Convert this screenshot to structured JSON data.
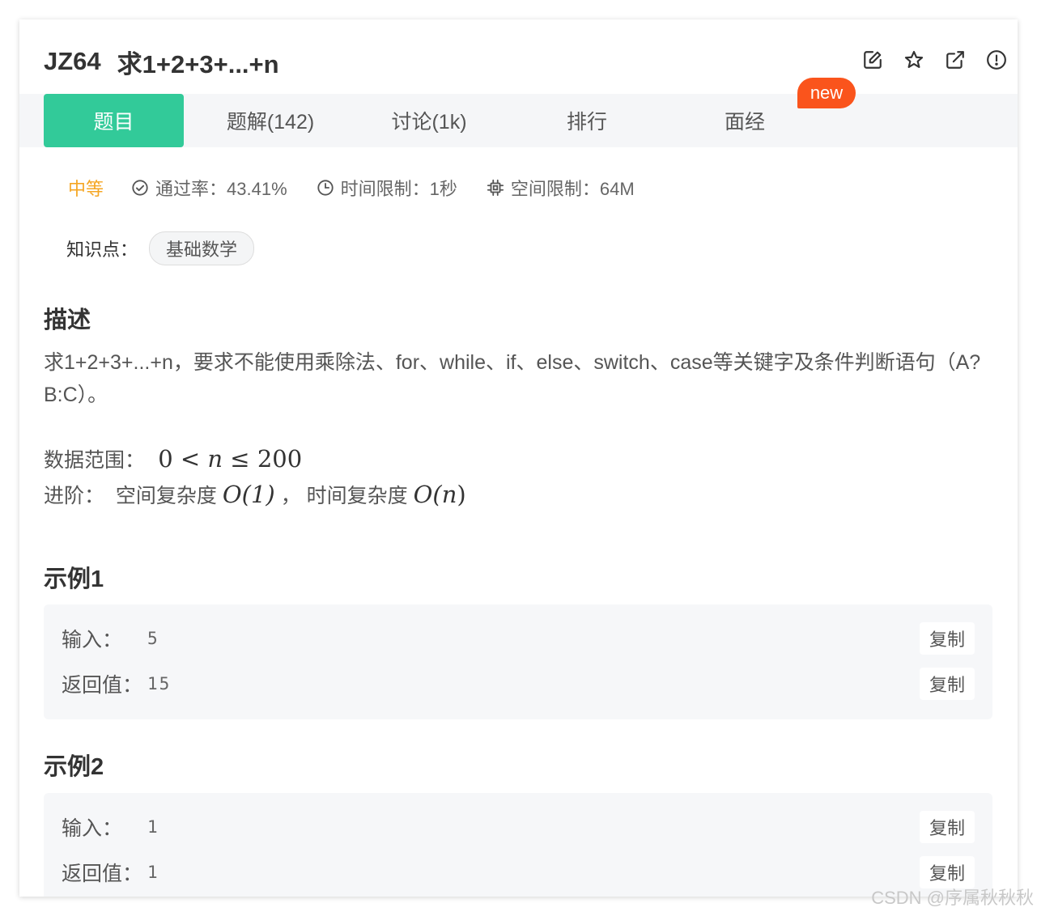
{
  "problem": {
    "id": "JZ64",
    "title": "求1+2+3+...+n"
  },
  "actions": [
    {
      "icon": "edit-icon"
    },
    {
      "icon": "star-icon"
    },
    {
      "icon": "share-icon"
    },
    {
      "icon": "report-icon"
    }
  ],
  "tabs": [
    {
      "label": "题目",
      "active": true
    },
    {
      "label": "题解(142)"
    },
    {
      "label": "讨论(1k)"
    },
    {
      "label": "排行"
    },
    {
      "label": "面经"
    }
  ],
  "new_badge": "new",
  "meta": {
    "difficulty": "中等",
    "pass_rate": "通过率：43.41%",
    "time_limit": "时间限制：1秒",
    "space_limit": "空间限制：64M"
  },
  "knowledge": {
    "label": "知识点：",
    "tag": "基础数学"
  },
  "description": {
    "heading": "描述",
    "text": "求1+2+3+...+n，要求不能使用乘除法、for、while、if、else、switch、case等关键字及条件判断语句（A?B:C）。",
    "range_label": "数据范围：",
    "range_zero": "0",
    "range_lt": "<",
    "range_n": "n",
    "range_le": "≤",
    "range_max": "200",
    "advanced_label": "进阶：",
    "space_label": "空间复杂度",
    "space_big_o": "O(1)",
    "comma": "，",
    "time_label": "时间复杂度",
    "time_big_o_open": "O(",
    "time_big_o_var": "n",
    "time_big_o_close": ")"
  },
  "examples": [
    {
      "heading": "示例1",
      "input_label": "输入：",
      "input": "5",
      "output_label": "返回值：",
      "output": "15",
      "copy_label": "复制"
    },
    {
      "heading": "示例2",
      "input_label": "输入：",
      "input": "1",
      "output_label": "返回值：",
      "output": "1",
      "copy_label": "复制"
    }
  ],
  "watermark": "CSDN @序属秋秋秋",
  "colors": {
    "accent": "#32ca99",
    "new_badge": "#fa541c",
    "medium": "#f5a623"
  }
}
